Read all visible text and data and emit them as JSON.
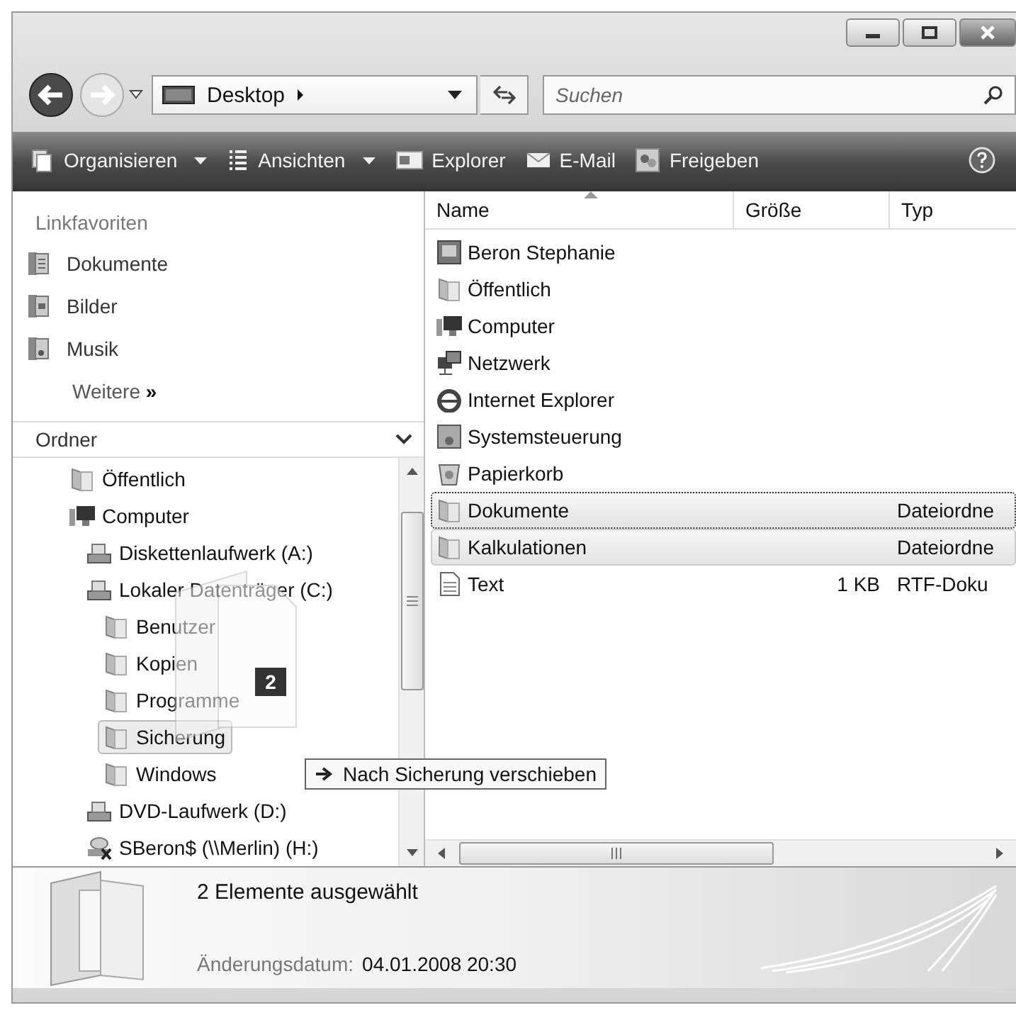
{
  "window": {
    "buttons": [
      {
        "kind": "minimize"
      },
      {
        "kind": "maximize"
      },
      {
        "kind": "close"
      }
    ]
  },
  "address": {
    "location": "Desktop",
    "search_placeholder": "Suchen"
  },
  "toolbar": [
    {
      "label": "Organisieren",
      "kind": "organize",
      "dropdown": true
    },
    {
      "label": "Ansichten",
      "kind": "views",
      "dropdown": true
    },
    {
      "label": "Explorer",
      "kind": "explorer",
      "dropdown": false
    },
    {
      "label": "E-Mail",
      "kind": "mail",
      "dropdown": false
    },
    {
      "label": "Freigeben",
      "kind": "share",
      "dropdown": false
    }
  ],
  "favorites": {
    "title": "Linkfavoriten",
    "items": [
      {
        "label": "Dokumente",
        "kind": "documents"
      },
      {
        "label": "Bilder",
        "kind": "pictures"
      },
      {
        "label": "Musik",
        "kind": "music"
      }
    ],
    "more": "Weitere",
    "more_glyph": "»"
  },
  "folders": {
    "title": "Ordner",
    "tree": [
      {
        "label": "Öffentlich",
        "kind": "folder",
        "highlighted": false
      },
      {
        "label": "Computer",
        "kind": "computer",
        "highlighted": false,
        "children": [
          {
            "label": "Diskettenlaufwerk (A:)",
            "kind": "floppy",
            "highlighted": false
          },
          {
            "label": "Lokaler Datenträger (C:)",
            "kind": "disk",
            "highlighted": false,
            "children": [
              {
                "label": "Benutzer",
                "kind": "folder",
                "highlighted": false
              },
              {
                "label": "Kopien",
                "kind": "folder",
                "highlighted": false
              },
              {
                "label": "Programme",
                "kind": "folder",
                "highlighted": false
              },
              {
                "label": "Sicherung",
                "kind": "folder",
                "highlighted": true
              },
              {
                "label": "Windows",
                "kind": "folder",
                "highlighted": false
              }
            ]
          },
          {
            "label": "DVD-Laufwerk (D:)",
            "kind": "dvd",
            "highlighted": false
          },
          {
            "label": "SBeron$ (\\\\Merlin) (H:)",
            "kind": "netdrive",
            "highlighted": false
          }
        ]
      }
    ]
  },
  "drag": {
    "count": "2",
    "tooltip": "Nach Sicherung verschieben"
  },
  "table": {
    "columns": [
      "Name",
      "Größe",
      "Typ"
    ],
    "rows": [
      {
        "name": "Beron Stephanie",
        "kind": "user",
        "size": "",
        "type": "",
        "selected": false,
        "focused": false
      },
      {
        "name": "Öffentlich",
        "kind": "folder",
        "size": "",
        "type": "",
        "selected": false,
        "focused": false
      },
      {
        "name": "Computer",
        "kind": "computer",
        "size": "",
        "type": "",
        "selected": false,
        "focused": false
      },
      {
        "name": "Netzwerk",
        "kind": "network",
        "size": "",
        "type": "",
        "selected": false,
        "focused": false
      },
      {
        "name": "Internet Explorer",
        "kind": "browser",
        "size": "",
        "type": "",
        "selected": false,
        "focused": false
      },
      {
        "name": "Systemsteuerung",
        "kind": "control",
        "size": "",
        "type": "",
        "selected": false,
        "focused": false
      },
      {
        "name": "Papierkorb",
        "kind": "bin",
        "size": "",
        "type": "",
        "selected": false,
        "focused": false
      },
      {
        "name": "Dokumente",
        "kind": "folder",
        "size": "",
        "type": "Dateiordne",
        "selected": true,
        "focused": true
      },
      {
        "name": "Kalkulationen",
        "kind": "folder",
        "size": "",
        "type": "Dateiordne",
        "selected": true,
        "focused": false
      },
      {
        "name": "Text",
        "kind": "doc",
        "size": "1 KB",
        "type": "RTF-Doku",
        "selected": false,
        "focused": false
      }
    ]
  },
  "details": {
    "summary": "2 Elemente ausgewählt",
    "date_label": "Änderungsdatum:",
    "date_value": "04.01.2008 20:30"
  }
}
